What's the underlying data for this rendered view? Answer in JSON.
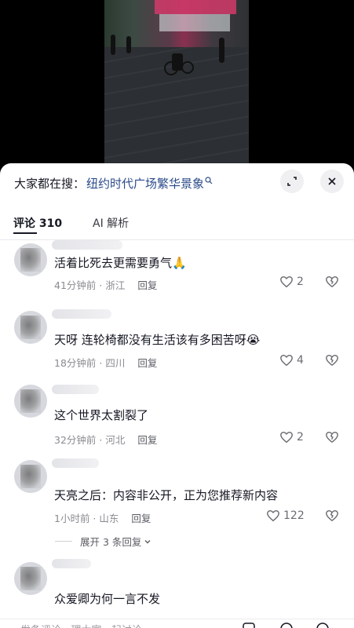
{
  "search": {
    "prefix": "大家都在搜：",
    "term": "纽约时代广场繁华景象"
  },
  "tabs": [
    {
      "label": "评论 310"
    },
    {
      "label": "AI 解析"
    }
  ],
  "comments": [
    {
      "text": "活着比死去更需要勇气",
      "emoji": "🙏",
      "time": "41分钟前 · 浙江",
      "reply": "回复",
      "likes": "2"
    },
    {
      "text": "天呀 连轮椅都没有生活该有多困苦呀",
      "emoji": "😭",
      "time": "18分钟前 · 四川",
      "reply": "回复",
      "likes": "4"
    },
    {
      "text": "这个世界太割裂了",
      "emoji": "",
      "time": "32分钟前 · 河北",
      "reply": "回复",
      "likes": "2"
    },
    {
      "text": "天亮之后：内容非公开，正为您推荐新内容",
      "emoji": "",
      "time": "1小时前 · 山东",
      "reply": "回复",
      "likes": "122",
      "expand": "展开 3 条回复"
    },
    {
      "text": "众爱卿为何一言不发",
      "emoji": "",
      "time": "",
      "reply": "",
      "likes": ""
    }
  ],
  "bottom": {
    "placeholder": "发条评论 · 理大家 · 起讨论"
  },
  "colors": {
    "search_term": "#2a4a8a",
    "text": "#161823",
    "meta": "#8a8b91"
  }
}
